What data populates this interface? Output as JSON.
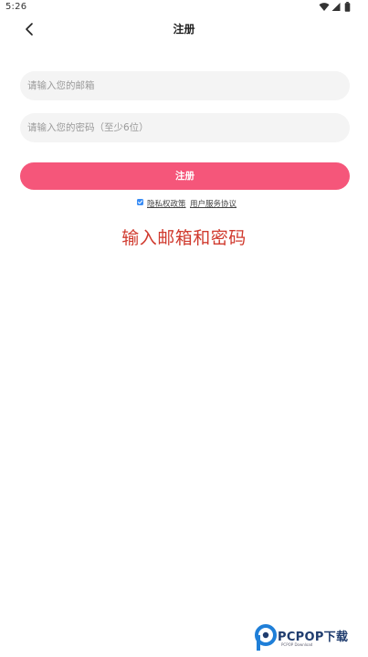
{
  "status_bar": {
    "time": "5:26",
    "icons": [
      "wifi-icon",
      "signal-icon",
      "battery-icon"
    ]
  },
  "header": {
    "title": "注册",
    "back_icon": "back-arrow-icon"
  },
  "form": {
    "email_placeholder": "请输入您的邮箱",
    "email_value": "",
    "password_placeholder": "请输入您的密码（至少6位）",
    "password_value": ""
  },
  "register_button": {
    "label": "注册"
  },
  "agreement": {
    "checked": true,
    "privacy_label": "隐私权政策",
    "terms_label": "用户服务协议"
  },
  "caption": "输入邮箱和密码",
  "watermark": {
    "text": "PCPOP下载",
    "subtext": "PCPOP Download"
  },
  "colors": {
    "accent": "#f5567a",
    "caption": "#d03a2e",
    "input_bg": "#f4f4f4",
    "checkbox": "#3a8df5"
  }
}
